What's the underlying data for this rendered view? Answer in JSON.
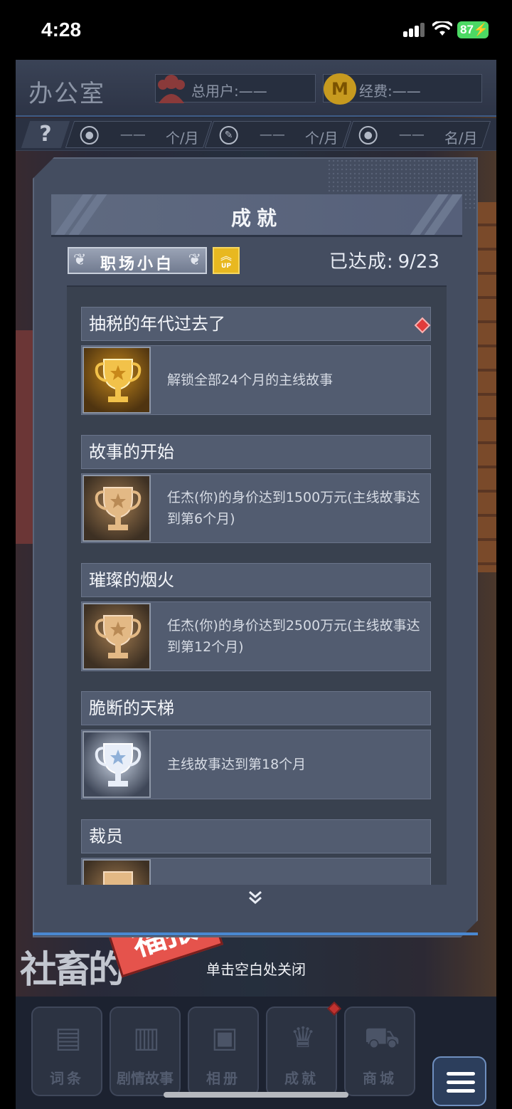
{
  "status_bar": {
    "time": "4:28",
    "battery": "87"
  },
  "header": {
    "title": "办公室",
    "users_label": "总用户:——",
    "funds_label": "经费:——",
    "rates": [
      {
        "icon": "lightbulb-icon",
        "value": "——",
        "unit": "个/月"
      },
      {
        "icon": "wrench-icon",
        "value": "——",
        "unit": "个/月"
      },
      {
        "icon": "person-icon",
        "value": "——",
        "unit": "名/月"
      }
    ],
    "help": "?"
  },
  "modal": {
    "title": "成就",
    "rank": "职场小白",
    "up_label": "UP",
    "progress_label": "已达成:",
    "progress_value": "9/23",
    "achievements": [
      {
        "name": "抽税的年代过去了",
        "desc": "解锁全部24个月的主线故事",
        "tier": "gold",
        "new": true
      },
      {
        "name": "故事的开始",
        "desc": "任杰(你)的身价达到1500万元(主线故事达到第6个月)",
        "tier": "bronze",
        "new": false
      },
      {
        "name": "璀璨的烟火",
        "desc": "任杰(你)的身价达到2500万元(主线故事达到第12个月)",
        "tier": "bronze",
        "new": false
      },
      {
        "name": "脆断的天梯",
        "desc": "主线故事达到第18个月",
        "tier": "silver",
        "new": false
      },
      {
        "name": "裁员",
        "desc": "",
        "tier": "bronze",
        "new": false
      }
    ],
    "more_icon": "double-chevron-down-icon"
  },
  "logo": {
    "text": "社畜的",
    "stamp": "福报"
  },
  "close_hint": "单击空白处关闭",
  "nav": [
    {
      "label": "词条",
      "icon": "notebook-icon",
      "badge": false
    },
    {
      "label": "剧情故事",
      "icon": "book-icon",
      "badge": false
    },
    {
      "label": "相册",
      "icon": "photo-icon",
      "badge": false
    },
    {
      "label": "成就",
      "icon": "trophy-icon",
      "badge": true
    },
    {
      "label": "商城",
      "icon": "cart-icon",
      "badge": false
    }
  ],
  "colors": {
    "panel": "#444d60",
    "accent_blue": "#4a88d1",
    "badge_red": "#e23b3b",
    "up_gold": "#e8b820"
  }
}
